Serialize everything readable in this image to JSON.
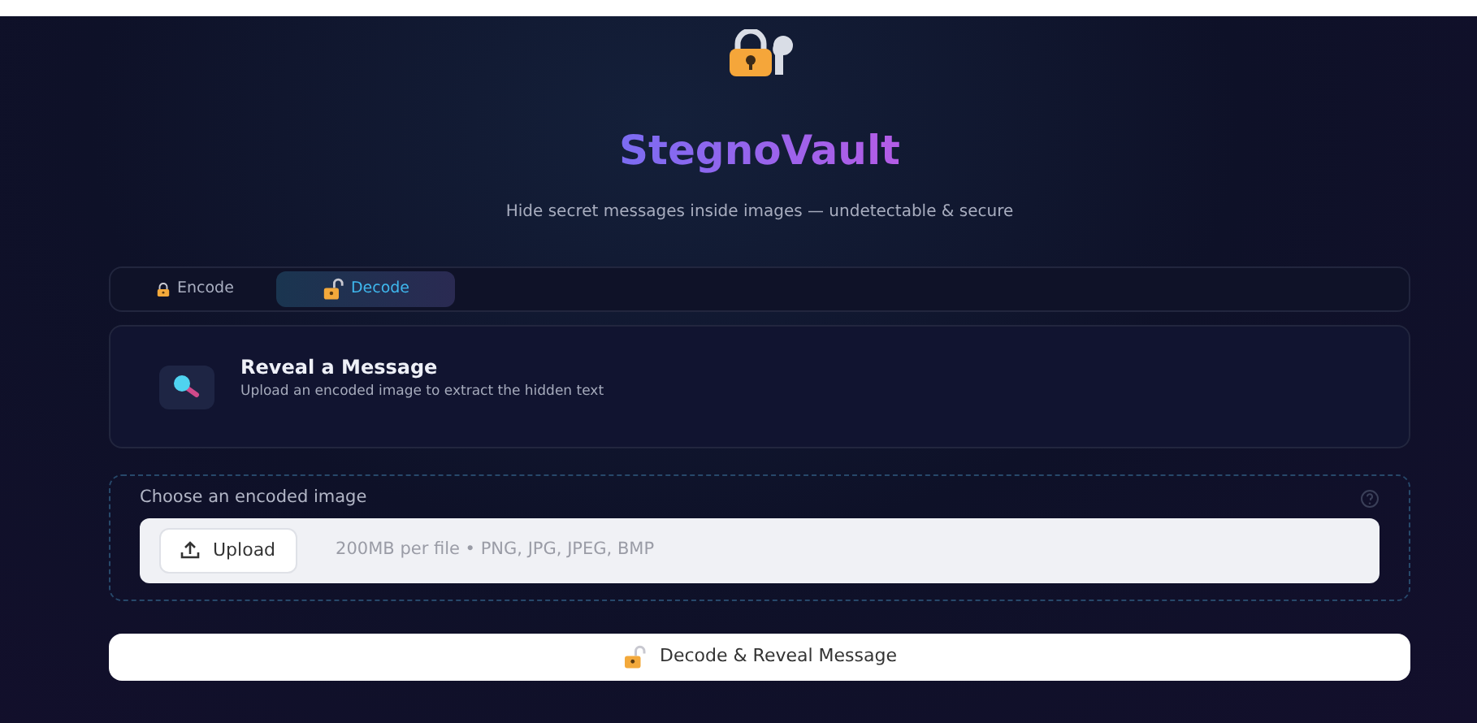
{
  "header": {
    "title": "StegnoVault",
    "subtitle": "Hide secret messages inside images — undetectable & secure"
  },
  "tabs": [
    {
      "label": "Encode",
      "kind": "lock",
      "selected": false
    },
    {
      "label": "Decode",
      "kind": "unlock",
      "selected": true
    }
  ],
  "section": {
    "title": "Reveal a Message",
    "description": "Upload an encoded image to extract the hidden text"
  },
  "uploader": {
    "label": "Choose an encoded image",
    "button": "Upload",
    "hint": "200MB per file • PNG, JPG, JPEG, BMP"
  },
  "action_button": {
    "label": "Decode & Reveal Message"
  }
}
